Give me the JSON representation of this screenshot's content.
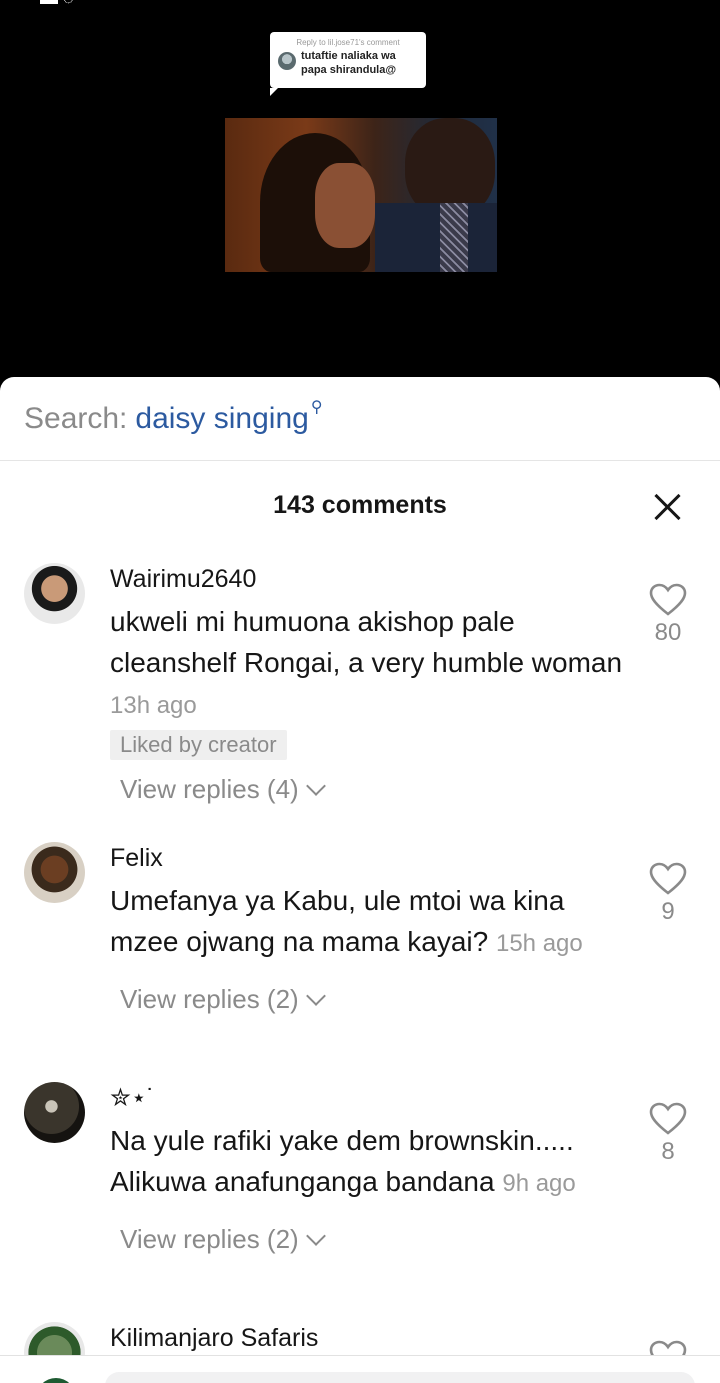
{
  "status_bar": {
    "time_text": ""
  },
  "video": {
    "reply_header": "Reply to lil.jose71's comment",
    "reply_text": "tutaftie naliaka wa papa shirandula@"
  },
  "search": {
    "label": "Search:",
    "term": "daisy singing"
  },
  "sheet": {
    "comment_count": "143 comments"
  },
  "comments": [
    {
      "user": "Wairimu2640",
      "text": "ukweli mi humuona akishop pale cleanshelf Rongai, a very humble woman",
      "time": "13h ago",
      "liked_badge": "Liked by creator",
      "view_replies": "View replies (4)",
      "likes": "80"
    },
    {
      "user": "Felix",
      "text": "Umefanya ya Kabu, ule mtoi wa kina mzee ojwang na mama kayai?",
      "time": "15h ago",
      "view_replies": "View replies (2)",
      "likes": "9"
    },
    {
      "user": "✮⋆˙",
      "text": "Na yule rafiki yake dem brownskin..... Alikuwa anafunganga bandana",
      "time": "9h ago",
      "view_replies": "View replies (2)",
      "likes": "8"
    },
    {
      "user": "Kilimanjaro Safaris",
      "text": "",
      "time": "",
      "likes": ""
    }
  ],
  "colors": {
    "accent_link": "#2c5aa0",
    "muted_text": "#8a8a8a",
    "primary_text": "#161616"
  }
}
